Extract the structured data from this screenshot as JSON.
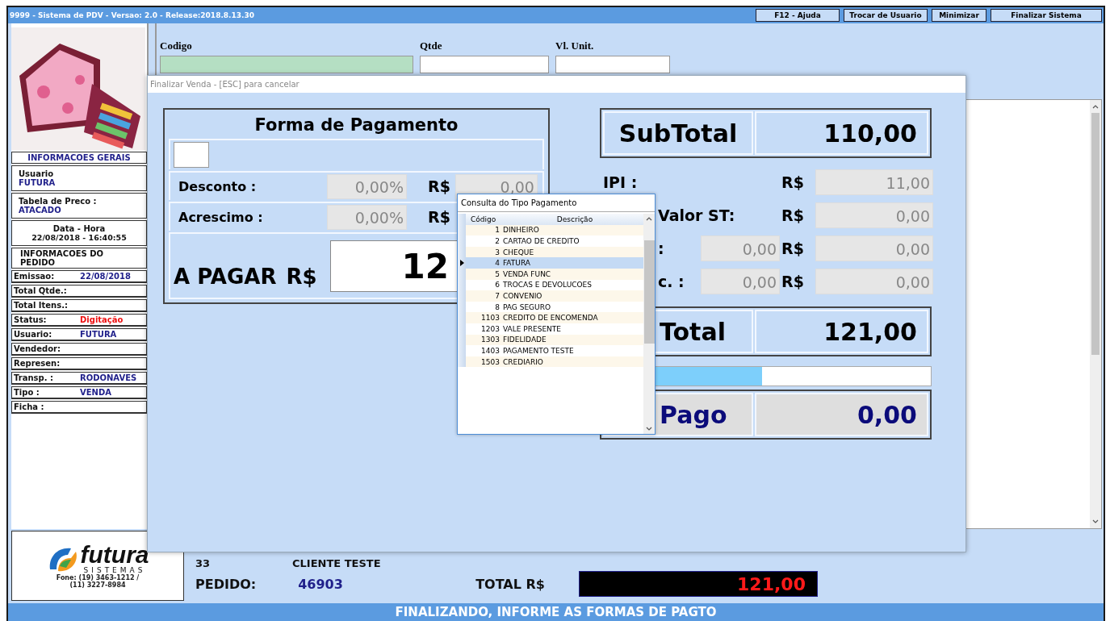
{
  "window": {
    "title": "9999 - Sistema de PDV - Versao: 2.0 - Release:2018.8.13.30",
    "buttons": [
      "F12 - Ajuda",
      "Trocar de Usuario",
      "Minimizar",
      "Finalizar Sistema"
    ]
  },
  "sidebar": {
    "general_heading": "INFORMACOES GERAIS",
    "user_label": "Usuario",
    "user": "FUTURA",
    "price_table_label": "Tabela de Preco :",
    "price_table": "ATACADO",
    "datetime_label": "Data - Hora",
    "datetime": "22/08/2018 - 16:40:55",
    "order_heading": "INFORMACOES DO PEDIDO",
    "order_fields": [
      {
        "label": "Emissao:",
        "value": "22/08/2018",
        "kind": "info"
      },
      {
        "label": "Total Qtde.:"
      },
      {
        "label": "Total Itens.:"
      },
      {
        "label": "Status:",
        "value": "Digitação",
        "kind": "alert"
      },
      {
        "label": "Usuario:",
        "value": "FUTURA",
        "kind": "info"
      },
      {
        "label": "Vendedor:"
      },
      {
        "label": "Represen:"
      },
      {
        "label": "Transp. :",
        "value": "RODONAVES",
        "kind": "info"
      },
      {
        "label": "Tipo :",
        "value": "VENDA",
        "kind": "info"
      },
      {
        "label": "Ficha :"
      }
    ]
  },
  "entry": {
    "code_label": "Codigo",
    "qty_label": "Qtde",
    "unit_price_label": "Vl. Unit."
  },
  "logo": {
    "name": "futura",
    "tagline": "SISTEMAS",
    "phone_lines": [
      "Fone: (19) 3463-1212 /",
      "(11) 3227-8984"
    ]
  },
  "footer": {
    "client_code": "33",
    "client_name": "CLIENTE TESTE",
    "order_label": "PEDIDO:",
    "order": "46903",
    "total_label": "TOTAL R$",
    "total": "121,00"
  },
  "status_bar": "FINALIZANDO, INFORME AS FORMAS DE PAGTO",
  "dialog": {
    "title": "Finalizar Venda - [ESC] para cancelar",
    "payment": {
      "heading": "Forma de Pagamento",
      "discount_label": "Desconto :",
      "discount_pct": "0,00%",
      "discount_currency": "R$",
      "discount_value": "0,00",
      "surcharge_label": "Acrescimo :",
      "surcharge_pct": "0,00%",
      "surcharge_currency": "R$",
      "due_label": "A PAGAR",
      "due_currency": "R$",
      "due": "12"
    },
    "totals": {
      "subtotal_label": "SubTotal",
      "subtotal": "110,00",
      "rows": [
        {
          "label": "IPI :",
          "currency": "R$",
          "value": "11,00"
        },
        {
          "label": "Valor ST:",
          "currency": "R$",
          "value": "0,00"
        },
        {
          "label": ":",
          "mid": "0,00",
          "currency": "R$",
          "value": "0,00"
        },
        {
          "label": "c. :",
          "mid": "0,00",
          "currency": "R$",
          "value": "0,00"
        }
      ],
      "total_label": "Total",
      "total": "121,00",
      "paid_progress": {
        "level": 0.49
      },
      "paid_label": "Pago",
      "paid": "0,00"
    }
  },
  "popup": {
    "title": "Consulta do Tipo Pagamento",
    "columns": [
      "Código",
      "Descrição"
    ],
    "rows": [
      {
        "code": "1",
        "description": "DINHEIRO",
        "selected": false
      },
      {
        "code": "2",
        "description": "CARTAO DE CREDITO",
        "selected": false
      },
      {
        "code": "3",
        "description": "CHEQUE",
        "selected": false
      },
      {
        "code": "4",
        "description": "FATURA",
        "selected": true
      },
      {
        "code": "5",
        "description": "VENDA FUNC",
        "selected": false
      },
      {
        "code": "6",
        "description": "TROCAS E DEVOLUCOES",
        "selected": false
      },
      {
        "code": "7",
        "description": "CONVENIO",
        "selected": false
      },
      {
        "code": "8",
        "description": "PAG SEGURO",
        "selected": false
      },
      {
        "code": "1103",
        "description": "CREDITO DE ENCOMENDA",
        "selected": false
      },
      {
        "code": "1203",
        "description": "VALE PRESENTE",
        "selected": false
      },
      {
        "code": "1303",
        "description": "FIDELIDADE",
        "selected": false
      },
      {
        "code": "1403",
        "description": "PAGAMENTO TESTE",
        "selected": false
      },
      {
        "code": "1503",
        "description": "CREDIARIO",
        "selected": false
      }
    ]
  }
}
